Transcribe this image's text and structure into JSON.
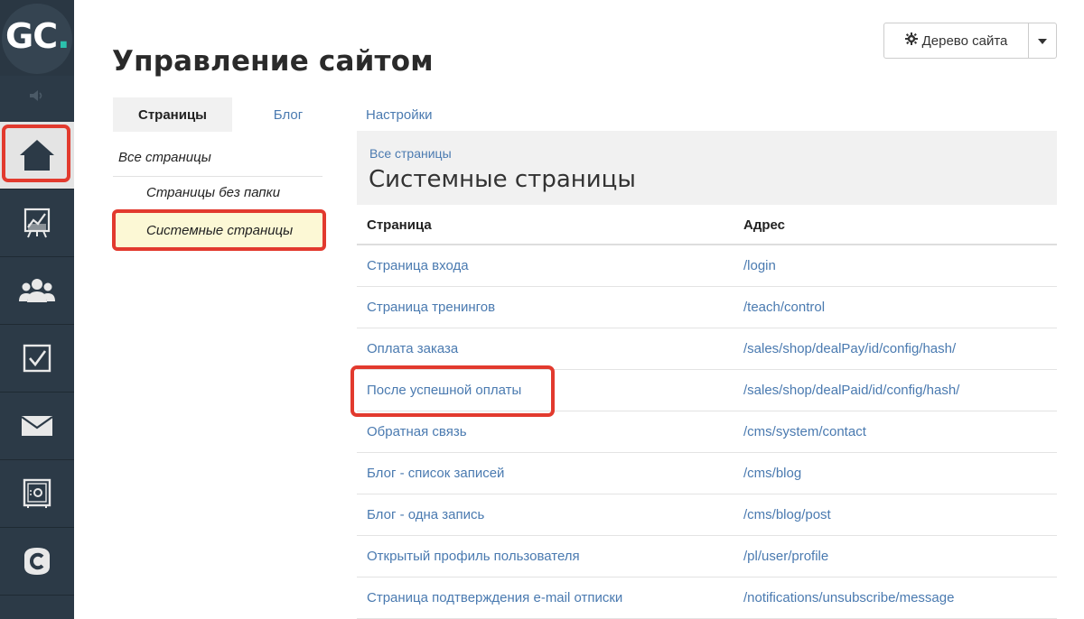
{
  "app": {
    "logo_text": "GC",
    "logo_dot": ".",
    "page_title": "Управление сайтом"
  },
  "sidebar": {
    "items": [
      {
        "name": "home",
        "icon": "home-icon"
      },
      {
        "name": "analytics",
        "icon": "chart-board-icon"
      },
      {
        "name": "users",
        "icon": "users-group-icon"
      },
      {
        "name": "tasks",
        "icon": "checkbox-icon"
      },
      {
        "name": "messages",
        "icon": "envelope-icon"
      },
      {
        "name": "safe",
        "icon": "safe-icon"
      },
      {
        "name": "copyright",
        "icon": "c-badge-icon"
      }
    ]
  },
  "toolbar": {
    "site_tree_label": "Дерево сайта"
  },
  "tabs": [
    {
      "label": "Страницы",
      "active": true
    },
    {
      "label": "Блог",
      "active": false
    },
    {
      "label": "Настройки",
      "active": false
    }
  ],
  "subnav": {
    "all": "Все страницы",
    "no_folder": "Страницы без папки",
    "system": "Системные страницы"
  },
  "header": {
    "breadcrumb": "Все страницы",
    "title": "Системные страницы"
  },
  "table": {
    "columns": [
      "Страница",
      "Адрес"
    ],
    "rows": [
      {
        "page": "Страница входа",
        "address": "/login"
      },
      {
        "page": "Страница тренингов",
        "address": "/teach/control"
      },
      {
        "page": "Оплата заказа",
        "address": "/sales/shop/dealPay/id/config/hash/"
      },
      {
        "page": "После успешной оплаты",
        "address": "/sales/shop/dealPaid/id/config/hash/"
      },
      {
        "page": "Обратная связь",
        "address": "/cms/system/contact"
      },
      {
        "page": "Блог - список записей",
        "address": "/cms/blog"
      },
      {
        "page": "Блог - одна запись",
        "address": "/cms/blog/post"
      },
      {
        "page": "Открытый профиль пользователя",
        "address": "/pl/user/profile"
      },
      {
        "page": "Страница подтверждения e-mail отписки",
        "address": "/notifications/unsubscribe/message"
      }
    ]
  },
  "colors": {
    "sidebar_bg": "#2c3a47",
    "accent_teal": "#2bc1ad",
    "link_blue": "#4a7ab0",
    "highlight_red": "#e23a2e",
    "selected_yellow": "#fcf8d5"
  }
}
